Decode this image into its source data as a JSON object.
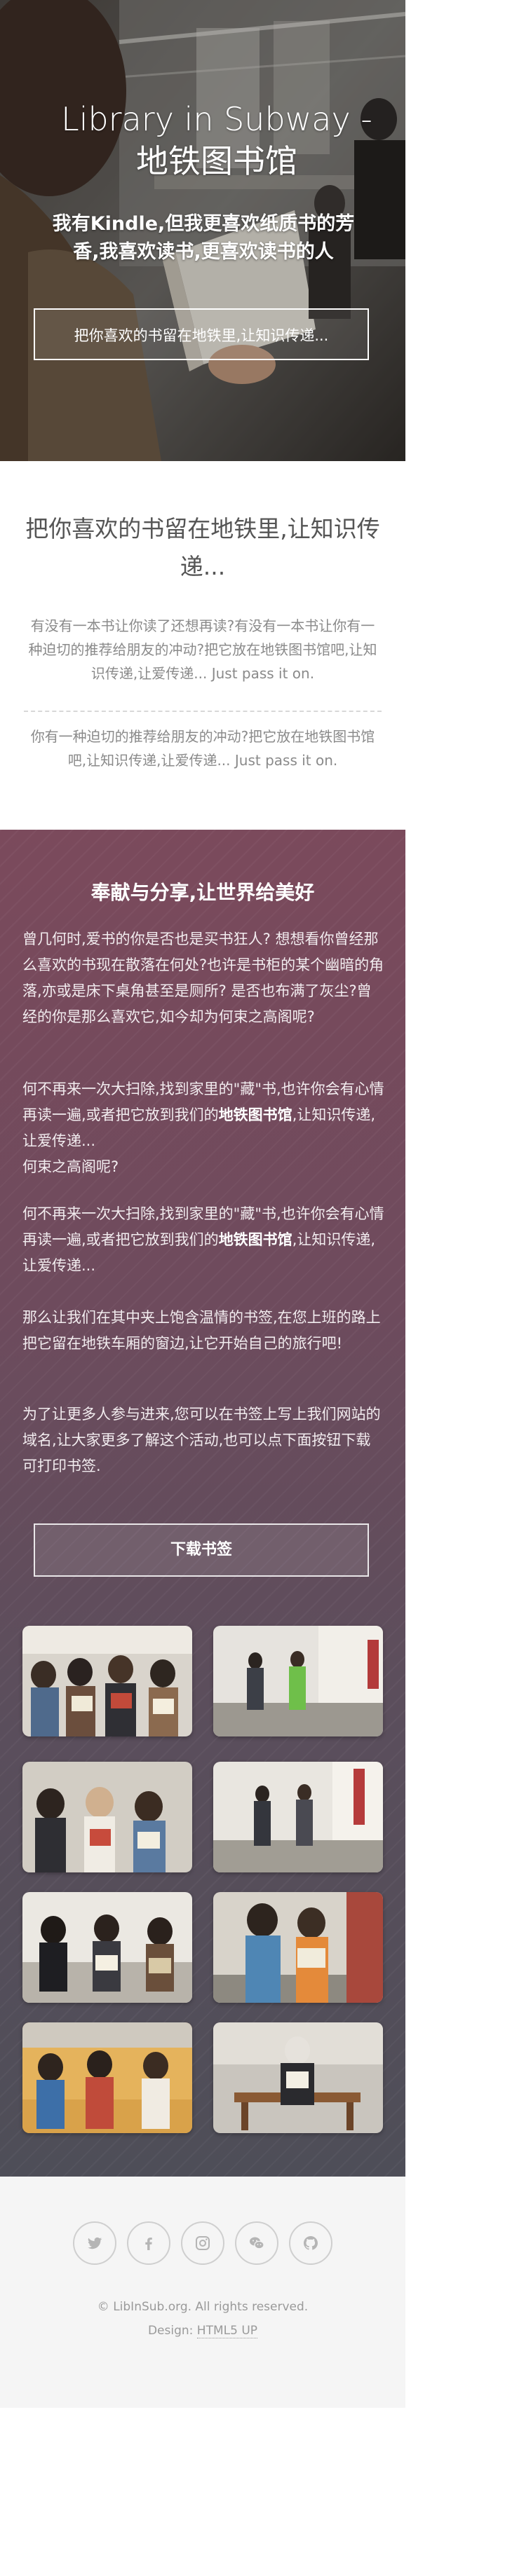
{
  "hero": {
    "title_en": "Library in Subway -",
    "title_zh": "地铁图书馆",
    "subtitle": "我有Kindle,但我更喜欢纸质书的芳香,我喜欢读书,更喜欢读书的人",
    "button_label": "把你喜欢的书留在地铁里,让知识传递..."
  },
  "intro": {
    "heading": "把你喜欢的书留在地铁里,让知识传递...",
    "paragraph_1": "有没有一本书让你读了还想再读?有没有一本书让你有一种迫切的推荐给朋友的冲动?把它放在地铁图书馆吧,让知识传递,让爱传递... Just pass it on.",
    "paragraph_2": "你有一种迫切的推荐给朋友的冲动?把它放在地铁图书馆吧,让知识传递,让爱传递... Just pass it on."
  },
  "feature": {
    "heading": "奉献与分享,让世界给美好",
    "p1": "曾几何时,爱书的你是否也是买书狂人? 想想看你曾经那么喜欢的书现在散落在何处?也许是书柜的某个幽暗的角落,亦或是床下桌角甚至是厕所? 是否也布满了灰尘?曾经的你是那么喜欢它,如今却为何束之高阁呢?",
    "p2_before": "何不再来一次大扫除,找到家里的\"藏\"书,也许你会有心情再读一遍,或者把它放到我们的",
    "p2_strong": "地铁图书馆",
    "p2_after": ",让知识传递,让爱传递...",
    "p2_tail": "何束之高阁呢?",
    "p3_before": "何不再来一次大扫除,找到家里的\"藏\"书,也许你会有心情再读一遍,或者把它放到我们的",
    "p3_strong": "地铁图书馆",
    "p3_after": ",让知识传递,让爱传递...",
    "p4": "那么让我们在其中夹上饱含温情的书签,在您上班的路上把它留在地铁车厢的窗边,让它开始自己的旅行吧!",
    "p5": "为了让更多人参与进来,您可以在书签上写上我们网站的域名,让大家更多了解这个活动,也可以点下面按钮下载可打印书签.",
    "download_label": "下载书签"
  },
  "gallery": {
    "items": [
      {
        "icon": "subway-readers-photo"
      },
      {
        "icon": "subway-platform-photo"
      },
      {
        "icon": "subway-readers-photo"
      },
      {
        "icon": "subway-platform-photo"
      },
      {
        "icon": "subway-readers-photo"
      },
      {
        "icon": "subway-platform-photo"
      },
      {
        "icon": "subway-readers-photo"
      },
      {
        "icon": "subway-bench-photo"
      }
    ]
  },
  "footer": {
    "social": [
      {
        "icon": "twitter-icon"
      },
      {
        "icon": "facebook-icon"
      },
      {
        "icon": "instagram-icon"
      },
      {
        "icon": "wechat-icon"
      },
      {
        "icon": "github-icon"
      }
    ],
    "copyright": "© LibInSub.org. All rights reserved.",
    "design_label": "Design:",
    "design_link": "HTML5 UP"
  },
  "colors": {
    "feature_top": "#7b4a5c",
    "feature_bottom": "#4e4e58",
    "footer_bg": "#f5f5f5",
    "footer_text": "#9a9a9a"
  }
}
